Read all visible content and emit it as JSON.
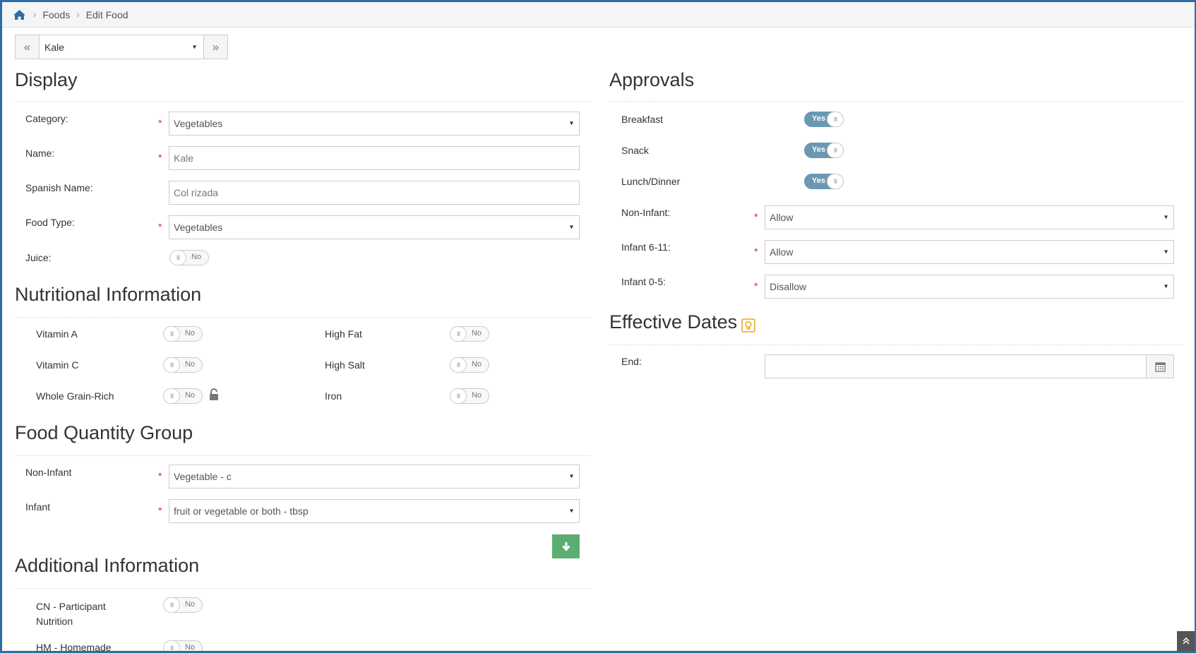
{
  "breadcrumb": {
    "items": [
      "Foods",
      "Edit Food"
    ]
  },
  "food_nav": {
    "selected": "Kale",
    "prev_icon": "«",
    "next_icon": "»"
  },
  "display": {
    "title": "Display",
    "category": {
      "label": "Category:",
      "value": "Vegetables"
    },
    "name": {
      "label": "Name:",
      "value": "Kale"
    },
    "spanish_name": {
      "label": "Spanish Name:",
      "value": "Col rizada"
    },
    "food_type": {
      "label": "Food Type:",
      "value": "Vegetables"
    },
    "juice": {
      "label": "Juice:",
      "value": "No"
    }
  },
  "nutrition": {
    "title": "Nutritional Information",
    "vitamin_a": {
      "label": "Vitamin A",
      "value": "No"
    },
    "vitamin_c": {
      "label": "Vitamin C",
      "value": "No"
    },
    "whole_grain": {
      "label": "Whole Grain-Rich",
      "value": "No"
    },
    "high_fat": {
      "label": "High Fat",
      "value": "No"
    },
    "high_salt": {
      "label": "High Salt",
      "value": "No"
    },
    "iron": {
      "label": "Iron",
      "value": "No"
    }
  },
  "quantity": {
    "title": "Food Quantity Group",
    "non_infant": {
      "label": "Non-Infant",
      "value": "Vegetable - c"
    },
    "infant": {
      "label": "Infant",
      "value": "fruit or vegetable or both - tbsp"
    }
  },
  "additional": {
    "title": "Additional Information",
    "cn": {
      "label_1": "CN - Participant",
      "label_2": "Nutrition",
      "value": "No"
    },
    "hm": {
      "label": "HM - Homemade",
      "value": "No"
    }
  },
  "approvals": {
    "title": "Approvals",
    "breakfast": {
      "label": "Breakfast",
      "value": "Yes"
    },
    "snack": {
      "label": "Snack",
      "value": "Yes"
    },
    "lunch_dinner": {
      "label": "Lunch/Dinner",
      "value": "Yes"
    },
    "non_infant": {
      "label": "Non-Infant:",
      "value": "Allow"
    },
    "infant_6_11": {
      "label": "Infant 6-11:",
      "value": "Allow"
    },
    "infant_0_5": {
      "label": "Infant 0-5:",
      "value": "Disallow"
    }
  },
  "effective_dates": {
    "title": "Effective Dates",
    "end": {
      "label": "End:",
      "value": ""
    }
  },
  "symbols": {
    "required": "*",
    "caret": "▾",
    "toggle_grip": "III"
  },
  "colors": {
    "toggle_on": "#6a98b3",
    "green_button": "#5cae70",
    "link_blue": "#2e6da4",
    "required_red": "#c9302c"
  }
}
